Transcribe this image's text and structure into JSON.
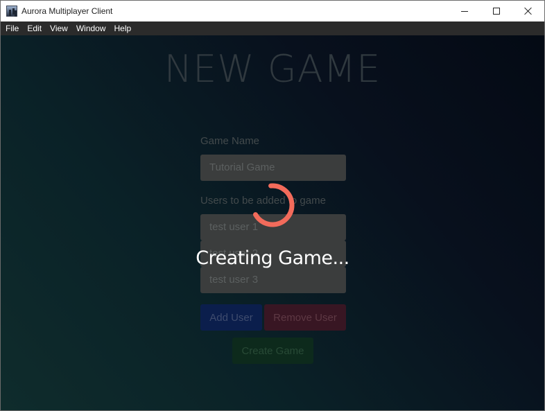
{
  "window": {
    "title": "Aurora Multiplayer Client"
  },
  "menubar": {
    "items": [
      "File",
      "Edit",
      "View",
      "Window",
      "Help"
    ]
  },
  "page": {
    "title": "NEW GAME",
    "game_name_label": "Game Name",
    "game_name_value": "Tutorial Game",
    "users_label": "Users to be added to game",
    "users": [
      "test user 1",
      "test user 2",
      "test user 3"
    ],
    "add_user_label": "Add User",
    "remove_user_label": "Remove User",
    "create_game_label": "Create Game"
  },
  "overlay": {
    "message": "Creating Game...",
    "spinner_color": "#f26b5b"
  },
  "icons": {
    "app": "aurora-app-icon",
    "minimize": "minimize-icon",
    "maximize": "maximize-icon",
    "close": "close-icon",
    "spinner": "loading-spinner-icon"
  },
  "colors": {
    "menubar_bg": "#2b2b2b",
    "add_user_bg": "#0b1e4c",
    "remove_user_bg": "#381623",
    "create_game_bg": "#0d2a1c"
  }
}
